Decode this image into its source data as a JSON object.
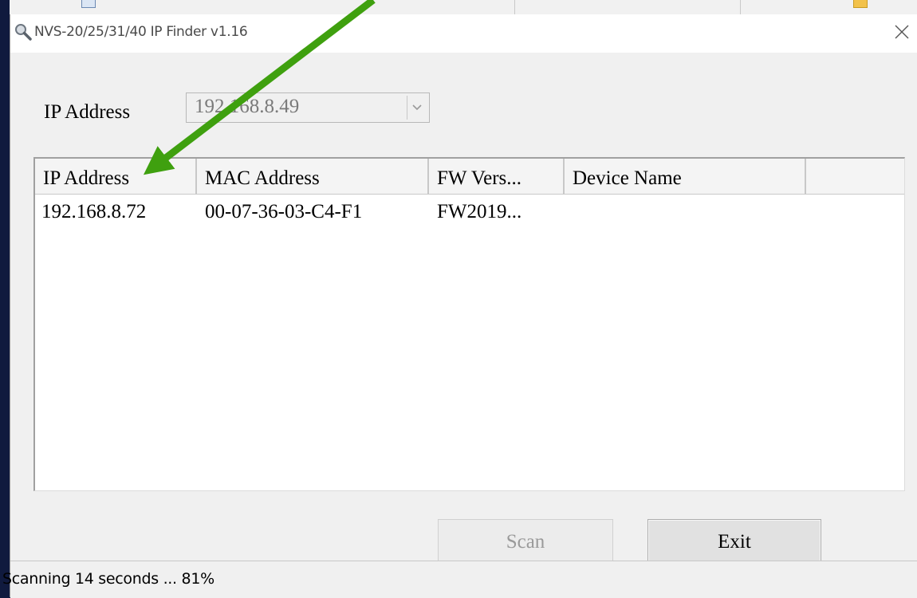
{
  "window": {
    "title": "NVS-20/25/31/40 IP Finder v1.16",
    "title_icon": "magnifier-icon",
    "close_icon": "close-icon"
  },
  "ip_selector": {
    "label": "IP Address",
    "value": "192.168.8.49"
  },
  "device_list": {
    "columns": [
      "IP Address",
      "MAC Address",
      "FW Vers...",
      "Device Name",
      ""
    ],
    "rows": [
      {
        "ip": "192.168.8.72",
        "mac": "00-07-36-03-C4-F1",
        "fw": "FW2019...",
        "name": ""
      }
    ]
  },
  "buttons": {
    "scan": "Scan",
    "exit": "Exit"
  },
  "status": {
    "text": "Scanning 14 seconds ... 81%"
  },
  "colors": {
    "background": "#101a3e",
    "annotation_arrow": "#3fa00f"
  }
}
